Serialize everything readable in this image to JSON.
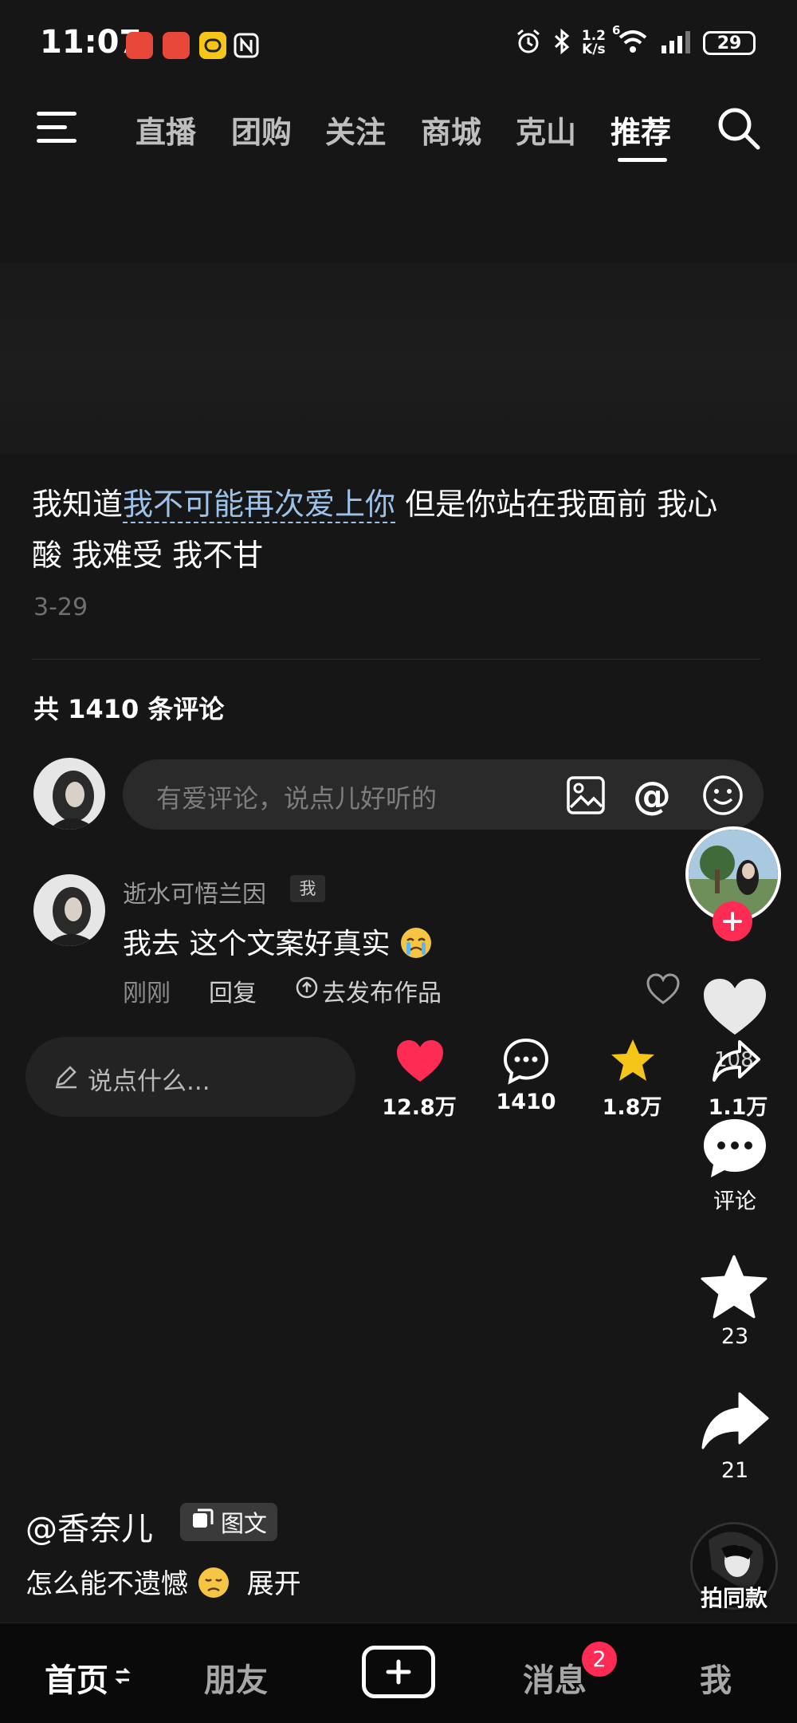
{
  "status_bar": {
    "time": "11:07",
    "network_speed_value": "1.2",
    "network_speed_unit": "K/s",
    "signal": "6",
    "battery": "29"
  },
  "top_nav": {
    "tabs": [
      "直播",
      "团购",
      "关注",
      "商城",
      "克山",
      "推荐"
    ],
    "active_tab": "推荐"
  },
  "post": {
    "caption_prefix": "我知道",
    "caption_keyword": "我不可能再次爱上你",
    "caption_line1_rest": " 但是你站在我面前 我心",
    "caption_line2": "酸 我难受 我不甘",
    "date": "3-29",
    "comment_total": "共 1410 条评论",
    "author": "@香奈儿",
    "type_tag": "图文",
    "description": "怎么能不遗憾",
    "expand_label": "展开"
  },
  "comment_input": {
    "placeholder": "有爱评论，说点儿好听的"
  },
  "comment": {
    "author": "逝水可悟兰因",
    "badge": "我",
    "text": "我去 这个文案好真实",
    "time": "刚刚",
    "reply_label": "回复",
    "publish_label": "去发布作品",
    "like_count_overlay": "108"
  },
  "action_bar": {
    "say_placeholder": "说点什么...",
    "likes": "12.8万",
    "comments": "1410",
    "favorites": "1.8万",
    "shares": "1.1万"
  },
  "right_rail": {
    "comment_label": "评论",
    "favorite_count": "23",
    "share_count": "21",
    "same_style_label": "拍同款"
  },
  "bottom_nav": {
    "home": "首页",
    "friends": "朋友",
    "messages": "消息",
    "messages_badge": "2",
    "me": "我"
  },
  "colors": {
    "like_red": "#fe2c55",
    "favorite_yellow": "#f5c518",
    "link_blue": "#9dc2ea"
  }
}
